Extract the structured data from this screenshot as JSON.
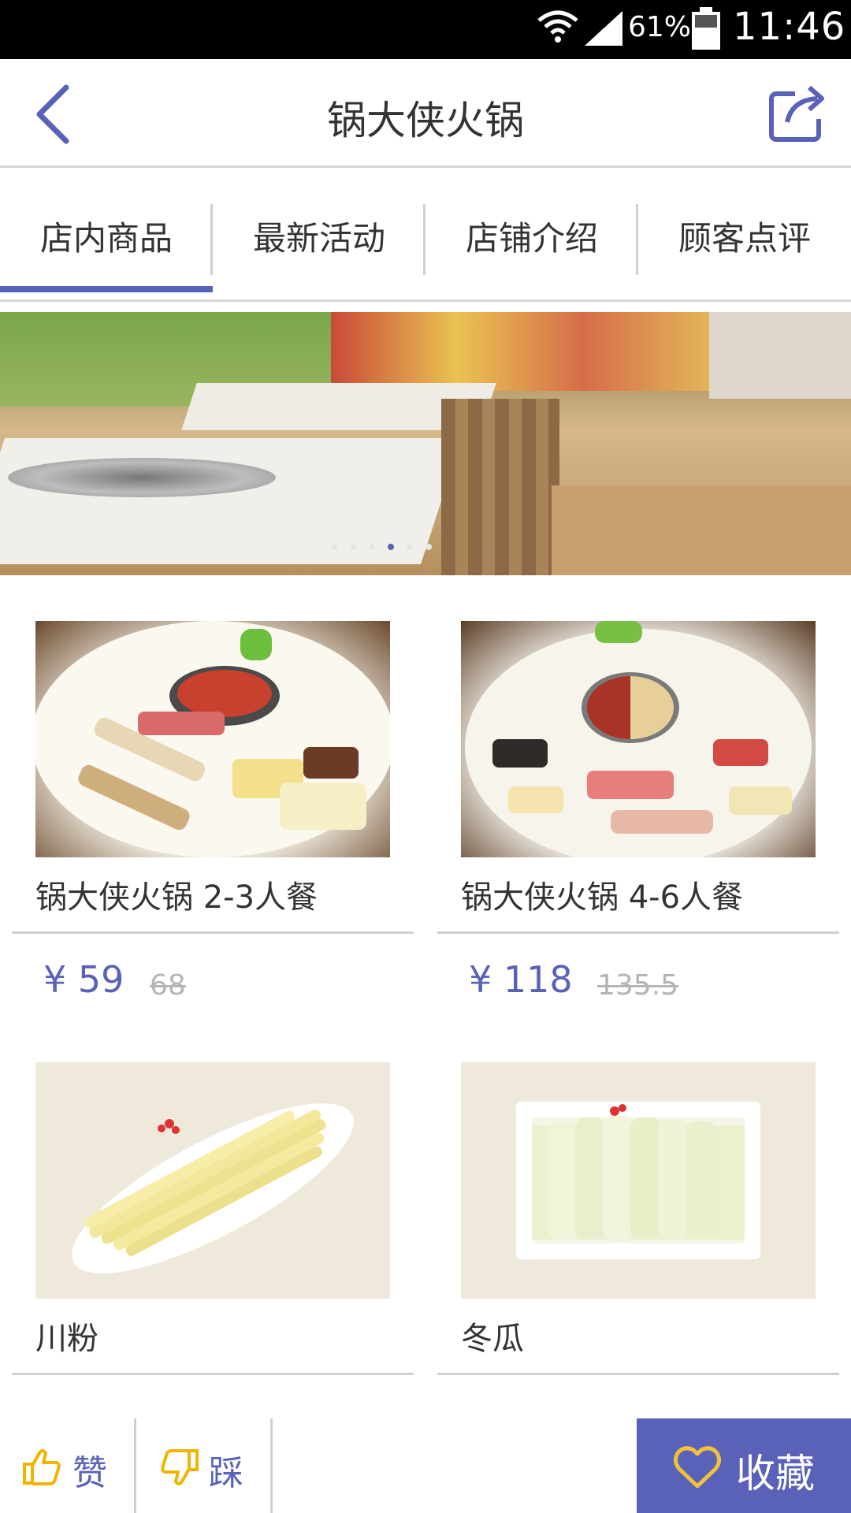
{
  "status_bar": {
    "battery_percent": "61%",
    "time": "11:46",
    "icons": [
      "wifi-icon",
      "signal-icon",
      "battery-icon"
    ]
  },
  "header": {
    "title": "锅大侠火锅",
    "back_icon": "back-chevron-icon",
    "share_icon": "share-icon"
  },
  "tabs": [
    {
      "label": "店内商品",
      "active": true
    },
    {
      "label": "最新活动",
      "active": false
    },
    {
      "label": "店铺介绍",
      "active": false
    },
    {
      "label": "顾客点评",
      "active": false
    }
  ],
  "banner": {
    "dot_count": 6,
    "active_dot_index": 3
  },
  "products": [
    {
      "name": "锅大侠火锅  2-3人餐",
      "price": "¥ 59",
      "original_price": "68"
    },
    {
      "name": "锅大侠火锅 4-6人餐",
      "price": "¥ 118",
      "original_price": "135.5"
    },
    {
      "name": "川粉"
    },
    {
      "name": "冬瓜"
    }
  ],
  "bottom_bar": {
    "like_label": "赞",
    "dislike_label": "踩",
    "favorite_label": "收藏"
  },
  "colors": {
    "accent": "#5961b8",
    "favorite_icon": "#f0c23a",
    "thumb_icon": "#f0b400"
  }
}
